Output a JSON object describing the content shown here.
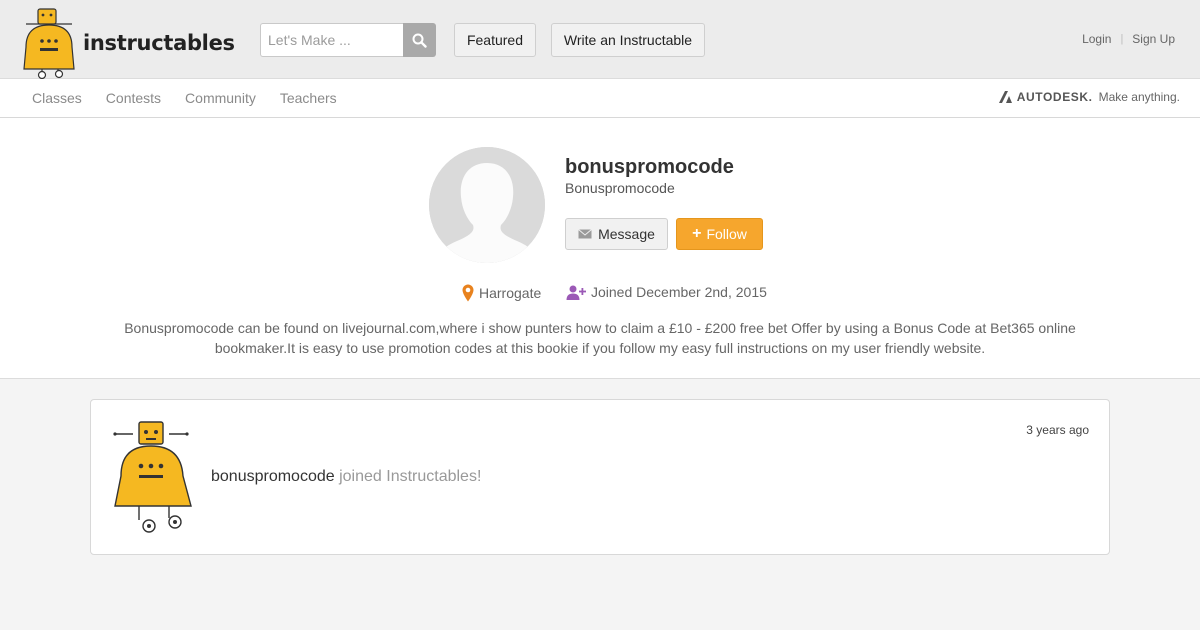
{
  "header": {
    "logo_text": "instructables",
    "search_placeholder": "Let's Make ...",
    "featured_label": "Featured",
    "write_label": "Write an Instructable",
    "login_label": "Login",
    "signup_label": "Sign Up",
    "separator": "|"
  },
  "subnav": {
    "links": [
      "Classes",
      "Contests",
      "Community",
      "Teachers"
    ],
    "autodesk_name": "AUTODESK.",
    "autodesk_tagline": "Make anything."
  },
  "profile": {
    "username": "bonuspromocode",
    "display_name": "Bonuspromocode",
    "message_label": "Message",
    "follow_label": "Follow",
    "location": "Harrogate",
    "joined": "Joined December 2nd, 2015",
    "bio": "Bonuspromocode can be found on livejournal.com,where i show punters how to claim a £10 - £200 free bet Offer by using a Bonus Code at Bet365 online bookmaker.It is easy to use promotion codes at this bookie if you follow my easy full instructions on my user friendly website."
  },
  "feed": {
    "items": [
      {
        "user": "bonuspromocode",
        "action": "joined Instructables!",
        "time": "3 years ago"
      }
    ]
  },
  "colors": {
    "follow_orange": "#f6a62d",
    "robot_yellow": "#f5b821",
    "location_pin": "#e8821e",
    "join_icon": "#9b59b6"
  }
}
